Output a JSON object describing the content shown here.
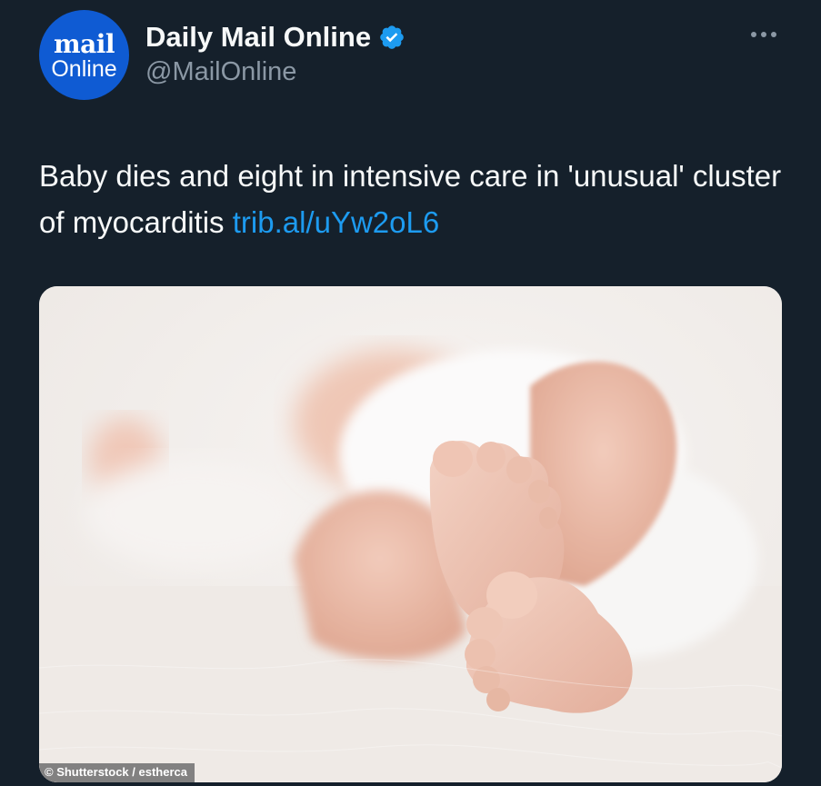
{
  "account": {
    "display_name": "Daily Mail Online",
    "handle": "@MailOnline",
    "avatar_logo_line1": "mail",
    "avatar_logo_line2": "Online",
    "verified_icon": "verified-badge-icon",
    "more_icon": "more-options-icon"
  },
  "tweet": {
    "text": "Baby dies and eight in intensive care in 'unusual' cluster of myocarditis ",
    "link_text": "trib.al/uYw2oL6"
  },
  "media": {
    "image_description_icon": "baby-feet-photo",
    "credit": "© Shutterstock / estherca"
  },
  "colors": {
    "background": "#15202b",
    "link": "#1d9bf0",
    "secondary_text": "#8b98a5",
    "verified": "#1d9bf0",
    "avatar": "#0f5bd3"
  }
}
